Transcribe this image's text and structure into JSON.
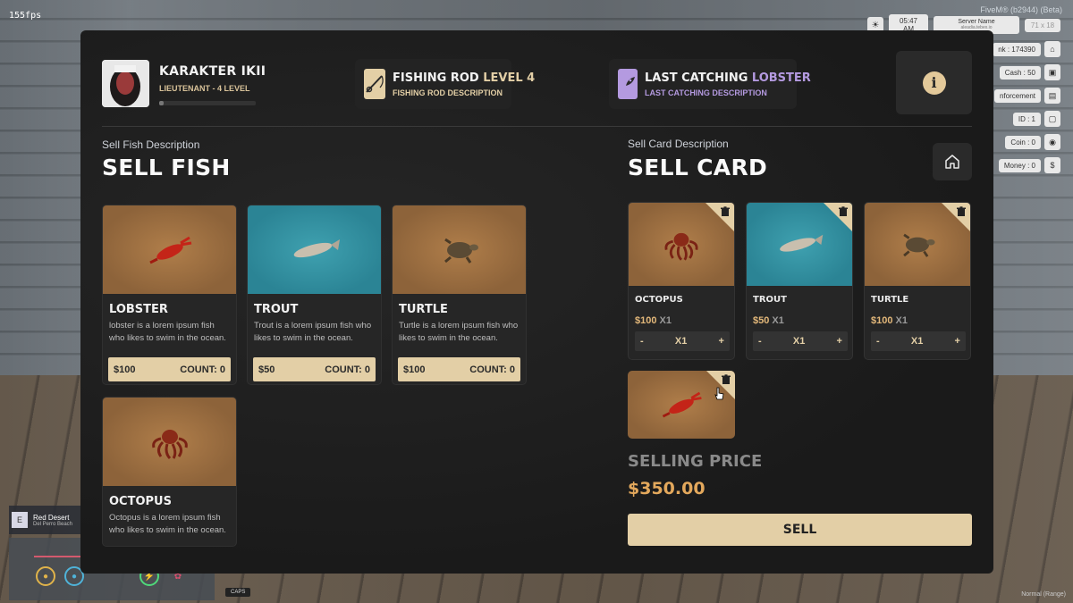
{
  "fps": "155fps",
  "hud": {
    "fivem": "FiveM® (b2944) (Beta)",
    "time": "05:47 AM",
    "server_name": "Server Name",
    "server_sub": "aleadia.tebex.io",
    "screen_size": "71 x 18",
    "stats": [
      {
        "label": "nk : 174390",
        "icon": "bank-icon"
      },
      {
        "label": "Cash : 50",
        "icon": "wallet-icon"
      },
      {
        "label": "nforcement",
        "icon": "card-icon"
      },
      {
        "label": "ID : 1",
        "icon": "id-icon"
      },
      {
        "label": "Coin : 0",
        "icon": "coin-icon"
      },
      {
        "label": "Money : 0",
        "icon": "dollar-icon"
      }
    ],
    "location": {
      "key": "E",
      "name": "Red Desert",
      "area": "Del Perro Beach"
    },
    "caps": "CAPS",
    "mode": "Normal (Range)"
  },
  "header": {
    "character_name": "KARAKTER IKII",
    "character_rank": "LIEUTENANT - 4 LEVEL",
    "xp_progress": 0.05,
    "rod": {
      "title": "FISHING ROD",
      "level": "LEVEL 4",
      "desc": "FISHING ROD DESCRIPTION"
    },
    "catch": {
      "title": "LAST CATCHING",
      "name": "LOBSTER",
      "desc": "LAST CATCHING DESCRIPTION"
    },
    "info_label": "i"
  },
  "sell_fish": {
    "desc": "Sell Fish Description",
    "title": "SELL FISH",
    "items": [
      {
        "name": "LOBSTER",
        "desc": "lobster is a lorem ipsum fish who likes to swim in the ocean.",
        "price": "$100",
        "count": "COUNT: 0",
        "bg": "sand",
        "icon": "lobster-icon"
      },
      {
        "name": "TROUT",
        "desc": "Trout is a lorem ipsum fish who likes to swim in the ocean.",
        "price": "$50",
        "count": "COUNT: 0",
        "bg": "water",
        "icon": "trout-icon"
      },
      {
        "name": "TURTLE",
        "desc": "Turtle is a lorem ipsum fish who likes to swim in the ocean.",
        "price": "$100",
        "count": "COUNT: 0",
        "bg": "sand",
        "icon": "turtle-icon"
      },
      {
        "name": "OCTOPUS",
        "desc": "Octopus is a lorem ipsum fish who likes to swim in the ocean.",
        "price": "",
        "count": "",
        "bg": "sand",
        "icon": "octopus-icon"
      }
    ]
  },
  "sell_card": {
    "desc": "Sell Card Description",
    "title": "SELL CARD",
    "items": [
      {
        "name": "OCTOPUS",
        "price": "$100",
        "qty": "X1",
        "stepper_value": "X1",
        "bg": "sand",
        "icon": "octopus-icon"
      },
      {
        "name": "TROUT",
        "price": "$50",
        "qty": "X1",
        "stepper_value": "X1",
        "bg": "water",
        "icon": "trout-icon"
      },
      {
        "name": "TURTLE",
        "price": "$100",
        "qty": "X1",
        "stepper_value": "X1",
        "bg": "sand",
        "icon": "turtle-icon"
      }
    ],
    "extra_item": {
      "bg": "sand",
      "icon": "lobster-icon"
    },
    "minus": "-",
    "plus": "+",
    "selling_price_label": "SELLING PRICE",
    "selling_price_value": "$350.00",
    "sell_button": "SELL"
  }
}
